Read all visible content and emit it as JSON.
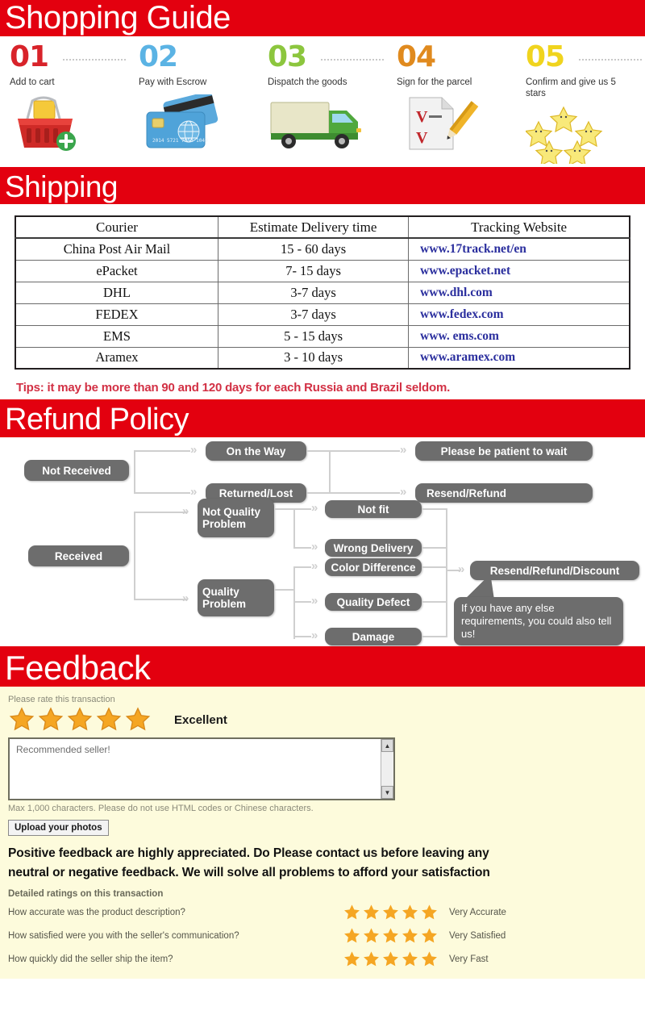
{
  "sections": {
    "shopping_guide_title": "Shopping Guide",
    "shipping_title": "Shipping",
    "refund_title": "Refund Policy",
    "feedback_title": "Feedback"
  },
  "steps": [
    {
      "num": "01",
      "label": "Add to cart",
      "icon": "shopping-basket-icon",
      "color": "#d8232a"
    },
    {
      "num": "02",
      "label": "Pay with Escrow",
      "icon": "credit-card-icon",
      "color": "#5bb3e4"
    },
    {
      "num": "03",
      "label": "Dispatch the goods",
      "icon": "delivery-truck-icon",
      "color": "#8cc63e"
    },
    {
      "num": "04",
      "label": "Sign for the parcel",
      "icon": "sign-document-icon",
      "color": "#e08a1e"
    },
    {
      "num": "05",
      "label": "Confirm and give us 5 stars",
      "icon": "five-stars-icon",
      "color": "#f0d41e"
    }
  ],
  "shipping": {
    "columns": [
      "Courier",
      "Estimate Delivery time",
      "Tracking Website"
    ],
    "rows": [
      {
        "courier": "China Post Air Mail",
        "time": "15 - 60 days",
        "site": "www.17track.net/en"
      },
      {
        "courier": "ePacket",
        "time": "7- 15 days",
        "site": "www.epacket.net"
      },
      {
        "courier": "DHL",
        "time": "3-7 days",
        "site": "www.dhl.com"
      },
      {
        "courier": "FEDEX",
        "time": "3-7 days",
        "site": "www.fedex.com"
      },
      {
        "courier": "EMS",
        "time": "5 - 15 days",
        "site": "www. ems.com"
      },
      {
        "courier": "Aramex",
        "time": "3 - 10 days",
        "site": "www.aramex.com"
      }
    ],
    "tips": "Tips: it may be more than 90 and 120 days for each Russia and Brazil seldom."
  },
  "refund_flow": {
    "not_received": "Not Received",
    "on_the_way": "On the Way",
    "returned_lost": "Returned/Lost",
    "please_wait": "Please be patient to wait",
    "resend_refund": "Resend/Refund",
    "received": "Received",
    "not_quality_problem": "Not Quality Problem",
    "quality_problem": "Quality Problem",
    "not_fit": "Not fit",
    "wrong_delivery": "Wrong Delivery",
    "color_difference": "Color Difference",
    "quality_defect": "Quality Defect",
    "damage": "Damage",
    "resend_refund_discount": "Resend/Refund/Discount",
    "callout": "If you have any else requirements, you could also tell us!"
  },
  "feedback": {
    "rate_prompt": "Please rate this transaction",
    "rating_stars": 5,
    "rating_word": "Excellent",
    "comment_value": "Recommended seller!",
    "comment_note": "Max 1,000 characters. Please do not use HTML codes or Chinese characters.",
    "upload_label": "Upload your photos",
    "positive_line1": "Positive feedback are highly appreciated. Do Please contact us before leaving any",
    "positive_line2": "neutral or negative feedback. We will solve all problems to afford your satisfaction",
    "detailed_title": "Detailed ratings on this transaction",
    "detailed": [
      {
        "question": "How accurate was the product description?",
        "stars": 5,
        "value": "Very Accurate"
      },
      {
        "question": "How satisfied were you with the seller's communication?",
        "stars": 5,
        "value": "Very Satisfied"
      },
      {
        "question": "How quickly did the seller ship the item?",
        "stars": 5,
        "value": "Very Fast"
      }
    ],
    "scroll_up_icon": "▲",
    "scroll_down_icon": "▼"
  },
  "colors": {
    "banner_red": "#e3000f",
    "feedback_bg": "#fdfbdc",
    "flow_box": "#6d6d6d",
    "link_blue": "#2b2f9e",
    "tips_red": "#d23044",
    "star_orange": "#f5a623"
  }
}
